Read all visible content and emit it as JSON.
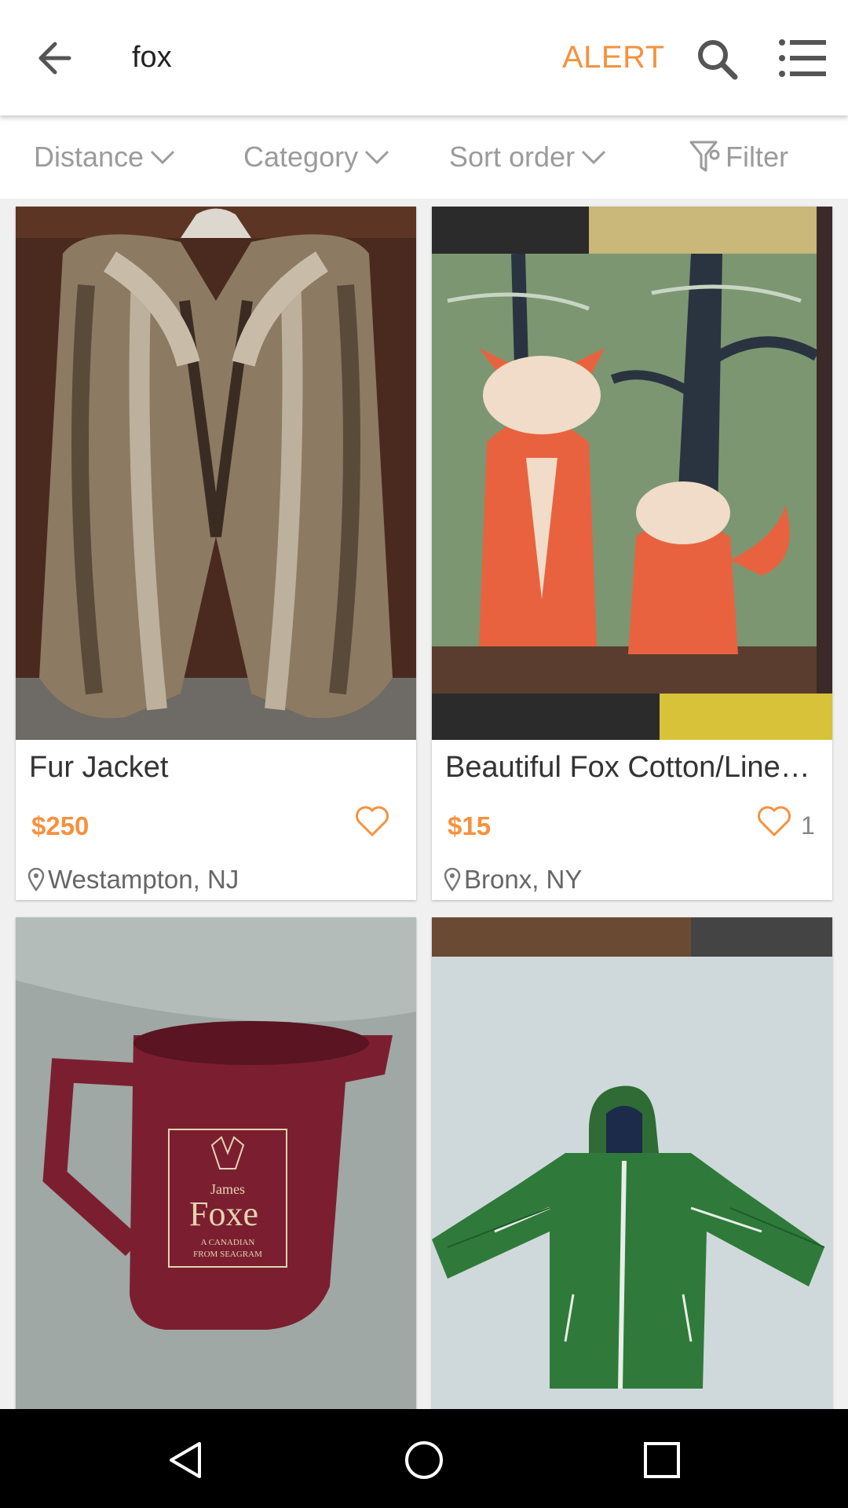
{
  "topbar": {
    "query": "fox",
    "alert_label": "ALERT",
    "icons": {
      "back": "arrow-left-icon",
      "search": "search-icon",
      "menu": "list-menu-icon"
    }
  },
  "filters": {
    "distance": "Distance",
    "category": "Category",
    "sort": "Sort order",
    "filter": "Filter"
  },
  "listings": [
    {
      "title": "Fur Jacket",
      "price": "$250",
      "likes": "",
      "location": "Westampton, NJ",
      "image": "fur-coat-photo"
    },
    {
      "title": "Beautiful Fox Cotton/Line…",
      "price": "$15",
      "likes": "1",
      "location": "Bronx, NY",
      "image": "fox-pillow-photo"
    },
    {
      "title": "",
      "price": "",
      "likes": "",
      "location": "",
      "image": "james-foxe-pitcher-photo",
      "image_text": {
        "brand_line1": "James",
        "brand_line2": "Foxe",
        "tagline1": "A CANADIAN",
        "tagline2": "FROM SEAGRAM"
      }
    },
    {
      "title": "",
      "price": "",
      "likes": "",
      "location": "",
      "image": "green-kids-jacket-photo"
    }
  ],
  "colors": {
    "accent": "#f6913d",
    "muted": "#9b9b9b",
    "background": "#f0f0f0"
  },
  "navbar": {
    "icons": [
      "back-triangle-icon",
      "home-circle-icon",
      "recents-square-icon"
    ]
  }
}
